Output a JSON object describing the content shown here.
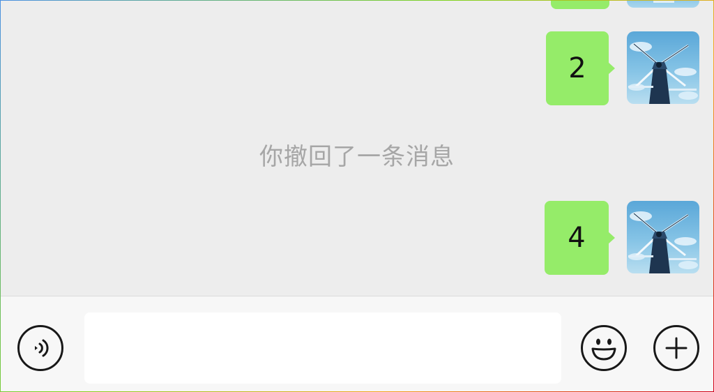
{
  "chat": {
    "messages": [
      {
        "sender": "self",
        "text": "2"
      },
      {
        "sender": "self",
        "text": "4"
      }
    ],
    "recall_notice": "你撤回了一条消息"
  },
  "input_bar": {
    "voice_icon": "voice-input-icon",
    "text_value": "",
    "emoji_icon": "emoji-smile-icon",
    "more_icon": "plus-circle-icon"
  },
  "colors": {
    "chat_background": "#ededed",
    "bubble_self": "#95ec69",
    "notice_text": "#a6a6a6",
    "input_bar_background": "#f7f7f7",
    "input_field": "#ffffff",
    "icon_stroke": "#181818"
  }
}
